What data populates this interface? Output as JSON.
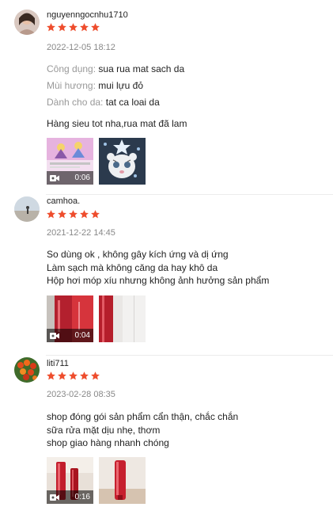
{
  "reviews": [
    {
      "username": "nguyenngocnhu1710",
      "rating": 5,
      "timestamp": "2022-12-05 18:12",
      "attributes": [
        {
          "label": "Công dụng:",
          "value": "sua rua mat sach da"
        },
        {
          "label": "Mùi hương:",
          "value": "mui lựu đỏ"
        },
        {
          "label": "Dành cho da:",
          "value": "tat ca loai da"
        }
      ],
      "lines": [
        "Hàng sieu tot nha,rua mat đã lam"
      ],
      "media": [
        {
          "type": "video",
          "duration": "0:06"
        },
        {
          "type": "image"
        }
      ]
    },
    {
      "username": "camhoa.",
      "rating": 5,
      "timestamp": "2021-12-22 14:45",
      "attributes": [],
      "lines": [
        "So dùng ok , không gây kích ứng và dị ứng",
        "Làm sạch mà không căng da hay khô da",
        "Hộp hơi móp xíu nhưng không ảnh hưởng sản phẩm"
      ],
      "media": [
        {
          "type": "video",
          "duration": "0:04"
        },
        {
          "type": "image"
        }
      ]
    },
    {
      "username": "liti711",
      "rating": 5,
      "timestamp": "2023-02-28 08:35",
      "attributes": [],
      "lines": [
        "shop đóng gói sản phẩm cẩn thận, chắc chắn",
        "sữa rửa mặt dịu nhẹ, thơm",
        "shop giao hàng nhanh chóng"
      ],
      "media": [
        {
          "type": "video",
          "duration": "0:16"
        },
        {
          "type": "image"
        }
      ]
    }
  ],
  "colors": {
    "star": "#ee4d2d",
    "text": "#222222",
    "muted": "#888888"
  }
}
